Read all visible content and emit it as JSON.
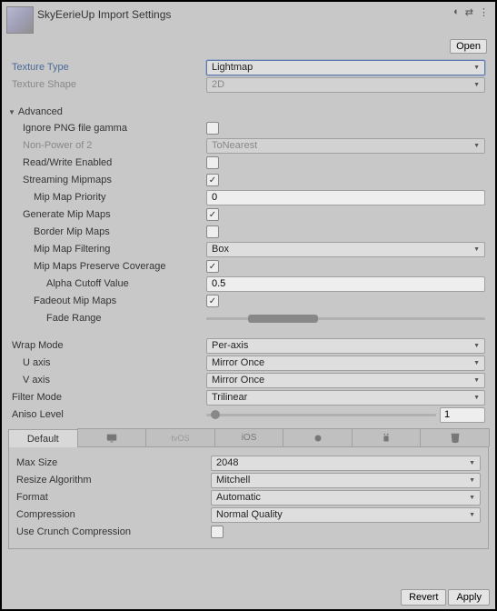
{
  "header": {
    "title": "SkyEerieUp Import Settings",
    "open": "Open"
  },
  "textureType": {
    "label": "Texture Type",
    "value": "Lightmap"
  },
  "textureShape": {
    "label": "Texture Shape",
    "value": "2D"
  },
  "advanced": {
    "label": "Advanced",
    "ignorePng": {
      "label": "Ignore PNG file gamma",
      "checked": false
    },
    "npot": {
      "label": "Non-Power of 2",
      "value": "ToNearest"
    },
    "readWrite": {
      "label": "Read/Write Enabled",
      "checked": false
    },
    "streaming": {
      "label": "Streaming Mipmaps",
      "checked": true
    },
    "mipPriority": {
      "label": "Mip Map Priority",
      "value": "0"
    },
    "generate": {
      "label": "Generate Mip Maps",
      "checked": true
    },
    "borderMip": {
      "label": "Border Mip Maps",
      "checked": false
    },
    "mipFilter": {
      "label": "Mip Map Filtering",
      "value": "Box"
    },
    "preserveCov": {
      "label": "Mip Maps Preserve Coverage",
      "checked": true
    },
    "alphaCutoff": {
      "label": "Alpha Cutoff Value",
      "value": "0.5"
    },
    "fadeout": {
      "label": "Fadeout Mip Maps",
      "checked": true
    },
    "fadeRange": {
      "label": "Fade Range"
    }
  },
  "wrapMode": {
    "label": "Wrap Mode",
    "value": "Per-axis"
  },
  "uAxis": {
    "label": "U axis",
    "value": "Mirror Once"
  },
  "vAxis": {
    "label": "V axis",
    "value": "Mirror Once"
  },
  "filterMode": {
    "label": "Filter Mode",
    "value": "Trilinear"
  },
  "aniso": {
    "label": "Aniso Level",
    "value": "1"
  },
  "tabs": {
    "default": "Default"
  },
  "platform": {
    "maxSize": {
      "label": "Max Size",
      "value": "2048"
    },
    "resizeAlg": {
      "label": "Resize Algorithm",
      "value": "Mitchell"
    },
    "format": {
      "label": "Format",
      "value": "Automatic"
    },
    "compression": {
      "label": "Compression",
      "value": "Normal Quality"
    },
    "crunch": {
      "label": "Use Crunch Compression",
      "checked": false
    }
  },
  "footer": {
    "revert": "Revert",
    "apply": "Apply"
  }
}
